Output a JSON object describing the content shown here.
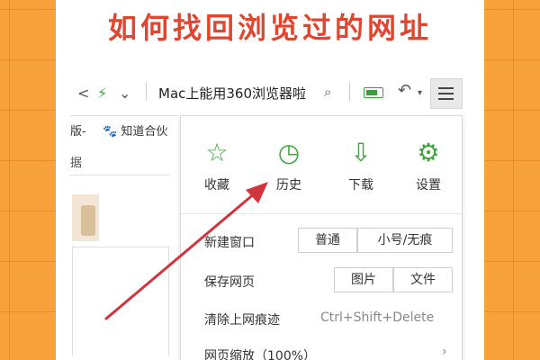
{
  "headline": "如何找回浏览过的网址",
  "toolbar": {
    "address_text": "Mac上能用360浏览器啦",
    "icons": [
      "share-icon",
      "bolt-icon",
      "chevron-down-icon",
      "search-icon",
      "battery-icon",
      "undo-icon",
      "menu-icon"
    ]
  },
  "bookmarks": {
    "item1": "版-",
    "item2": "知道合伙"
  },
  "sidebar": {
    "tab": "据"
  },
  "menu": {
    "quick_items": [
      {
        "label": "收藏",
        "icon": "star-icon"
      },
      {
        "label": "历史",
        "icon": "clock-icon"
      },
      {
        "label": "下载",
        "icon": "download-icon"
      },
      {
        "label": "设置",
        "icon": "gear-icon"
      }
    ],
    "rows": {
      "new_window": {
        "label": "新建窗口",
        "normal": "普通",
        "incognito": "小号/无痕"
      },
      "save_page": {
        "label": "保存网页",
        "image": "图片",
        "file": "文件"
      },
      "clear_history": {
        "label": "清除上网痕迹",
        "shortcut": "Ctrl+Shift+Delete"
      },
      "zoom": {
        "label": "网页缩放（100%）"
      }
    }
  },
  "colors": {
    "background": "#f7a13a",
    "headline": "#e0462f",
    "accent_green": "#3fa63f",
    "arrow": "#d1343c"
  }
}
